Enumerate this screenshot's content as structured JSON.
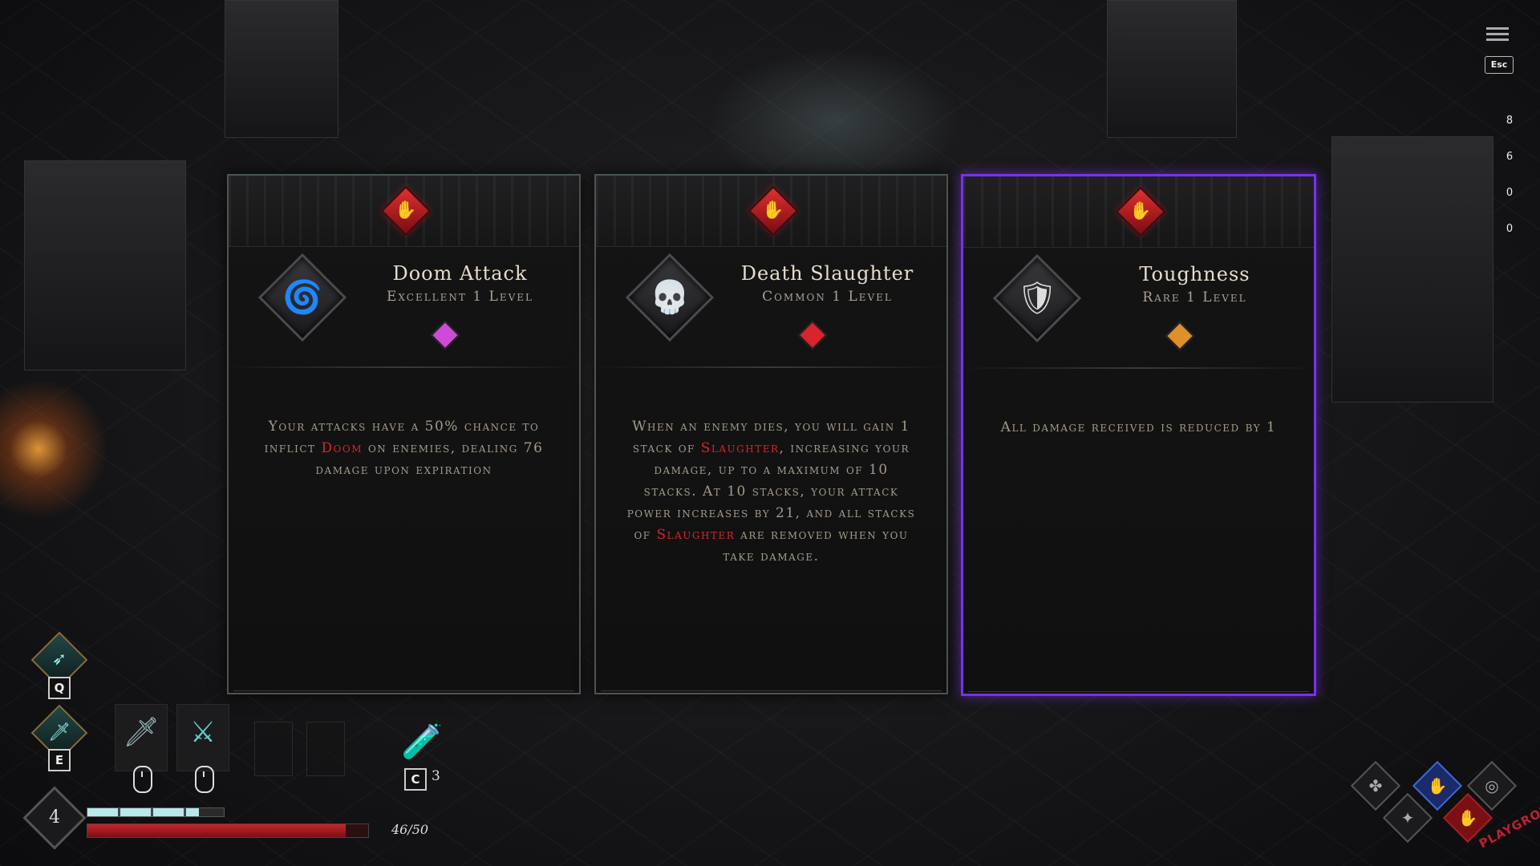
{
  "colors": {
    "keyword": "#d8242a",
    "selected_border": "#7b2ff0",
    "card_border": "#4a5553",
    "hp": "#c8262c",
    "xp": "#b8e8ea"
  },
  "cards": [
    {
      "title": "Doom Attack",
      "subtitle": "Excellent 1 Level",
      "icon": "doom-swirl-icon",
      "header_icon": "red-hand-icon",
      "rarity_color": "#d04ad8",
      "desc_parts": [
        "Your attacks have a 50% chance to inflict ",
        "Doom",
        " on enemies, dealing 76 damage upon expiration"
      ],
      "selected": false
    },
    {
      "title": "Death Slaughter",
      "subtitle": "Common 1 Level",
      "icon": "skull-icon",
      "header_icon": "red-hand-icon",
      "rarity_color": "#d8242a",
      "desc_parts": [
        "When an enemy dies, you will gain 1 stack of ",
        "Slaughter",
        ", increasing your damage, up to a maximum of 10 stacks. At 10 stacks, your attack power increases by 21, and all stacks of ",
        "Slaughter",
        " are removed when you take damage."
      ],
      "selected": false
    },
    {
      "title": "Toughness",
      "subtitle": "Rare 1 Level",
      "icon": "armor-icon",
      "header_icon": "red-hand-icon",
      "rarity_color": "#e0902a",
      "desc_parts": [
        "All damage received is reduced by 1"
      ],
      "selected": true
    }
  ],
  "top_right": {
    "esc_label": "Esc",
    "resources": [
      {
        "name": "coin-icon",
        "value": "8",
        "color": "#c08a4a"
      },
      {
        "name": "purple-flame-icon",
        "value": "6",
        "color": "#7a3ad0"
      },
      {
        "name": "blue-flame-icon",
        "value": "0",
        "color": "#3a6ad0"
      },
      {
        "name": "skull-token-icon",
        "value": "0",
        "color": "#8a7a6a"
      }
    ]
  },
  "hud": {
    "skill_q_key": "Q",
    "skill_e_key": "E",
    "potion_key": "C",
    "potion_count": "3",
    "level": "4",
    "hp_text": "46/50",
    "hp_fraction": 0.92,
    "xp_fraction": 0.82,
    "watermark": "PLAYGROUND"
  }
}
